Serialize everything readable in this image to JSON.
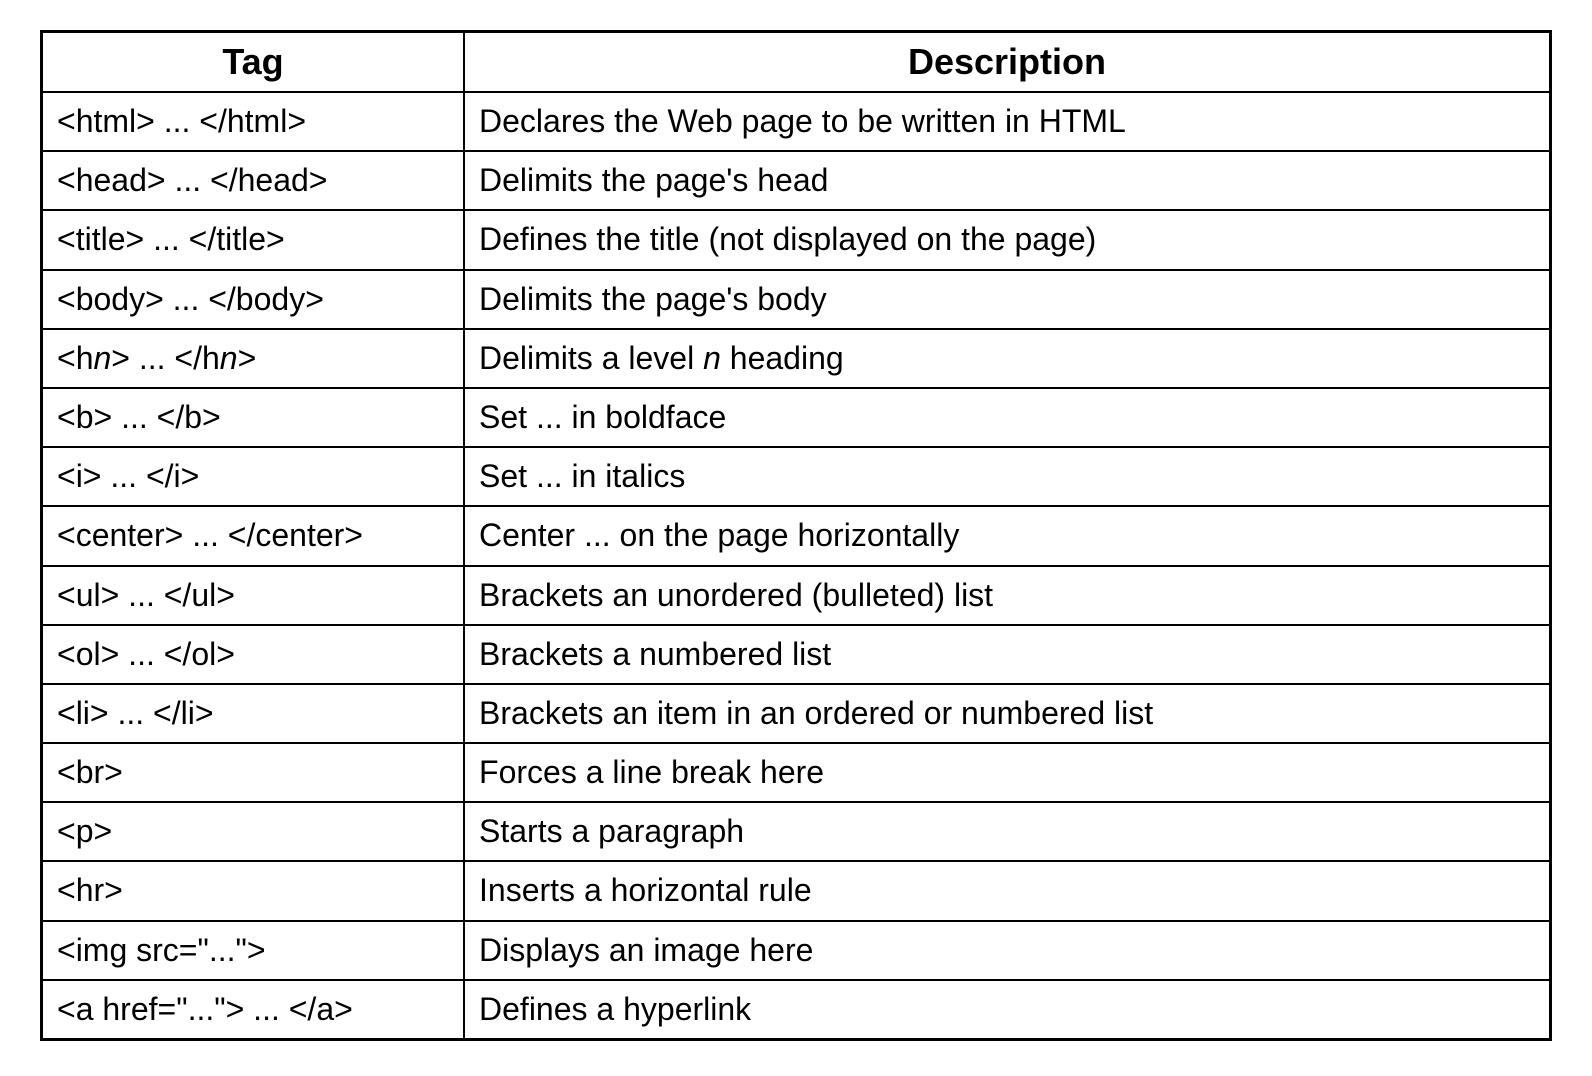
{
  "headers": {
    "tag": "Tag",
    "description": "Description"
  },
  "rows": [
    {
      "tag": "<html> ... </html>",
      "description": "Declares the Web page to be written in HTML"
    },
    {
      "tag": "<head> ... </head>",
      "description": "Delimits the page's head"
    },
    {
      "tag": "<title> ... </title>",
      "description": "Defines the title (not displayed on the page)"
    },
    {
      "tag_parts": [
        "<h",
        {
          "ital": "n"
        },
        "> ... </h",
        {
          "ital": "n"
        },
        ">"
      ],
      "tag": "<hn> ... </hn>",
      "description": "",
      "desc_parts": [
        "Delimits a level ",
        {
          "ital": "n"
        },
        " heading"
      ],
      "is_hn": true
    },
    {
      "tag": "<body> ... </body>",
      "description": "Delimits the page's body"
    },
    {
      "tag": "<b> ... </b>",
      "description": "Set ... in boldface"
    },
    {
      "tag": "<i> ... </i>",
      "description": "Set ... in italics"
    },
    {
      "tag": "<center>      ... </center>",
      "description": "Center ... on the page horizontally"
    },
    {
      "tag": "<ul> ... </ul>",
      "description": "Brackets an unordered (bulleted) list"
    },
    {
      "tag": "<ol> ... </ol>",
      "description": "Brackets a numbered list"
    },
    {
      "tag": "<li> ... </li>",
      "description": "Brackets an item in an ordered or numbered list"
    },
    {
      "tag": "<br>",
      "description": "Forces a line break here"
    },
    {
      "tag": "<p>",
      "description": "Starts a paragraph"
    },
    {
      "tag": "<hr>",
      "description": "Inserts a horizontal rule"
    },
    {
      "tag": "<img src=\"...\">",
      "description": "Displays an image here"
    },
    {
      "tag": "<a href=\"...\"> ... </a>",
      "description": "Defines a hyperlink"
    }
  ],
  "order": [
    0,
    1,
    2,
    4,
    3,
    5,
    6,
    7,
    8,
    9,
    10,
    11,
    12,
    13,
    14,
    15
  ]
}
